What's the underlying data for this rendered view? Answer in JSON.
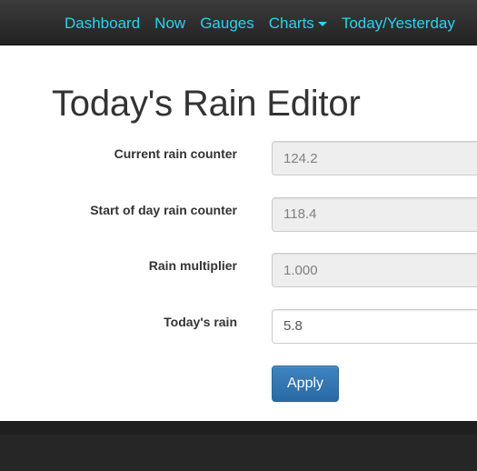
{
  "navbar": {
    "items": [
      {
        "label": "Dashboard",
        "has_caret": false
      },
      {
        "label": "Now",
        "has_caret": false
      },
      {
        "label": "Gauges",
        "has_caret": false
      },
      {
        "label": "Charts",
        "has_caret": true
      },
      {
        "label": "Today/Yesterday",
        "has_caret": false
      }
    ],
    "background_color": "#2b2b2b",
    "link_color": "#2ad2f0"
  },
  "page": {
    "title": "Today's Rain Editor"
  },
  "form": {
    "fields": [
      {
        "label": "Current rain counter",
        "value": "124.2",
        "placeholder": "",
        "disabled": true
      },
      {
        "label": "Start of day rain counter",
        "value": "118.4",
        "placeholder": "",
        "disabled": true
      },
      {
        "label": "Rain multiplier",
        "value": "1.000",
        "placeholder": "",
        "disabled": true
      },
      {
        "label": "Today's rain",
        "value": "5.8",
        "placeholder": "",
        "disabled": false
      }
    ],
    "submit_label": "Apply",
    "submit_color": "#337ab7"
  },
  "footer": {
    "background_color": "#262626"
  }
}
